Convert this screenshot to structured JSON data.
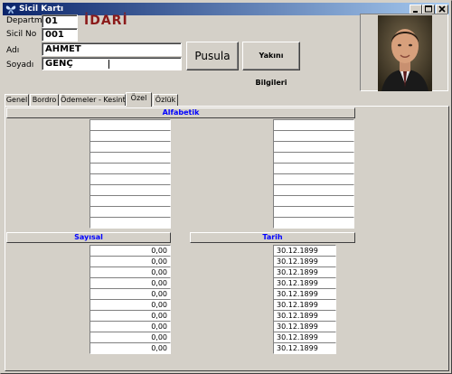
{
  "window": {
    "title": "Sicil Kartı"
  },
  "form": {
    "departman_label": "Departman",
    "departman_value": "01",
    "departman_name": "İDARİ",
    "sicil_label": "Sicil No",
    "sicil_value": "001",
    "adi_label": "Adı",
    "adi_value": "AHMET",
    "soyadi_label": "Soyadı",
    "soyadi_value": "GENÇ"
  },
  "buttons": {
    "pusula": "Pusula",
    "yakini": "Yakını Bilgileri"
  },
  "tabs": [
    "Genel",
    "Bordro",
    "Ödemeler - Kesintiler",
    "Özel",
    "Özlük"
  ],
  "active_tab": "Özel",
  "headers": {
    "alfabetik": "Alfabetik",
    "sayisal": "Sayısal",
    "tarih": "Tarih"
  },
  "alfabetik_left": [
    "",
    "",
    "",
    "",
    "",
    "",
    "",
    "",
    "",
    ""
  ],
  "alfabetik_right": [
    "",
    "",
    "",
    "",
    "",
    "",
    "",
    "",
    "",
    ""
  ],
  "sayisal": [
    "0,00",
    "0,00",
    "0,00",
    "0,00",
    "0,00",
    "0,00",
    "0,00",
    "0,00",
    "0,00",
    "0,00"
  ],
  "tarih": [
    "30.12.1899",
    "30.12.1899",
    "30.12.1899",
    "30.12.1899",
    "30.12.1899",
    "30.12.1899",
    "30.12.1899",
    "30.12.1899",
    "30.12.1899",
    "30.12.1899"
  ],
  "colors": {
    "header_text": "#0000ff",
    "dept_name": "#8b1a1a",
    "titlebar_start": "#0a246a",
    "titlebar_end": "#a6caf0"
  }
}
